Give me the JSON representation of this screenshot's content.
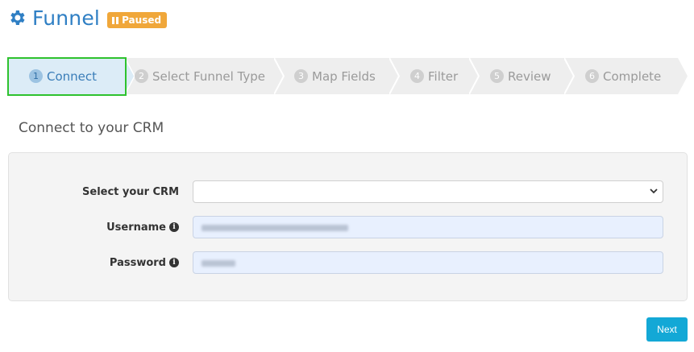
{
  "header": {
    "title": "Funnel",
    "status_badge": "Paused",
    "title_icon": "gear-icon",
    "title_color": "#2f7fc4",
    "badge_color": "#f0a73a"
  },
  "steps": [
    {
      "num": "1",
      "label": "Connect",
      "active": true
    },
    {
      "num": "2",
      "label": "Select Funnel Type",
      "active": false
    },
    {
      "num": "3",
      "label": "Map Fields",
      "active": false
    },
    {
      "num": "4",
      "label": "Filter",
      "active": false
    },
    {
      "num": "5",
      "label": "Review",
      "active": false
    },
    {
      "num": "6",
      "label": "Complete",
      "active": false
    }
  ],
  "section": {
    "title": "Connect to your CRM"
  },
  "form": {
    "crm_label": "Select your CRM",
    "crm_value": "",
    "username_label": "Username",
    "password_label": "Password"
  },
  "actions": {
    "next_label": "Next",
    "accent": "#13a8d6"
  }
}
